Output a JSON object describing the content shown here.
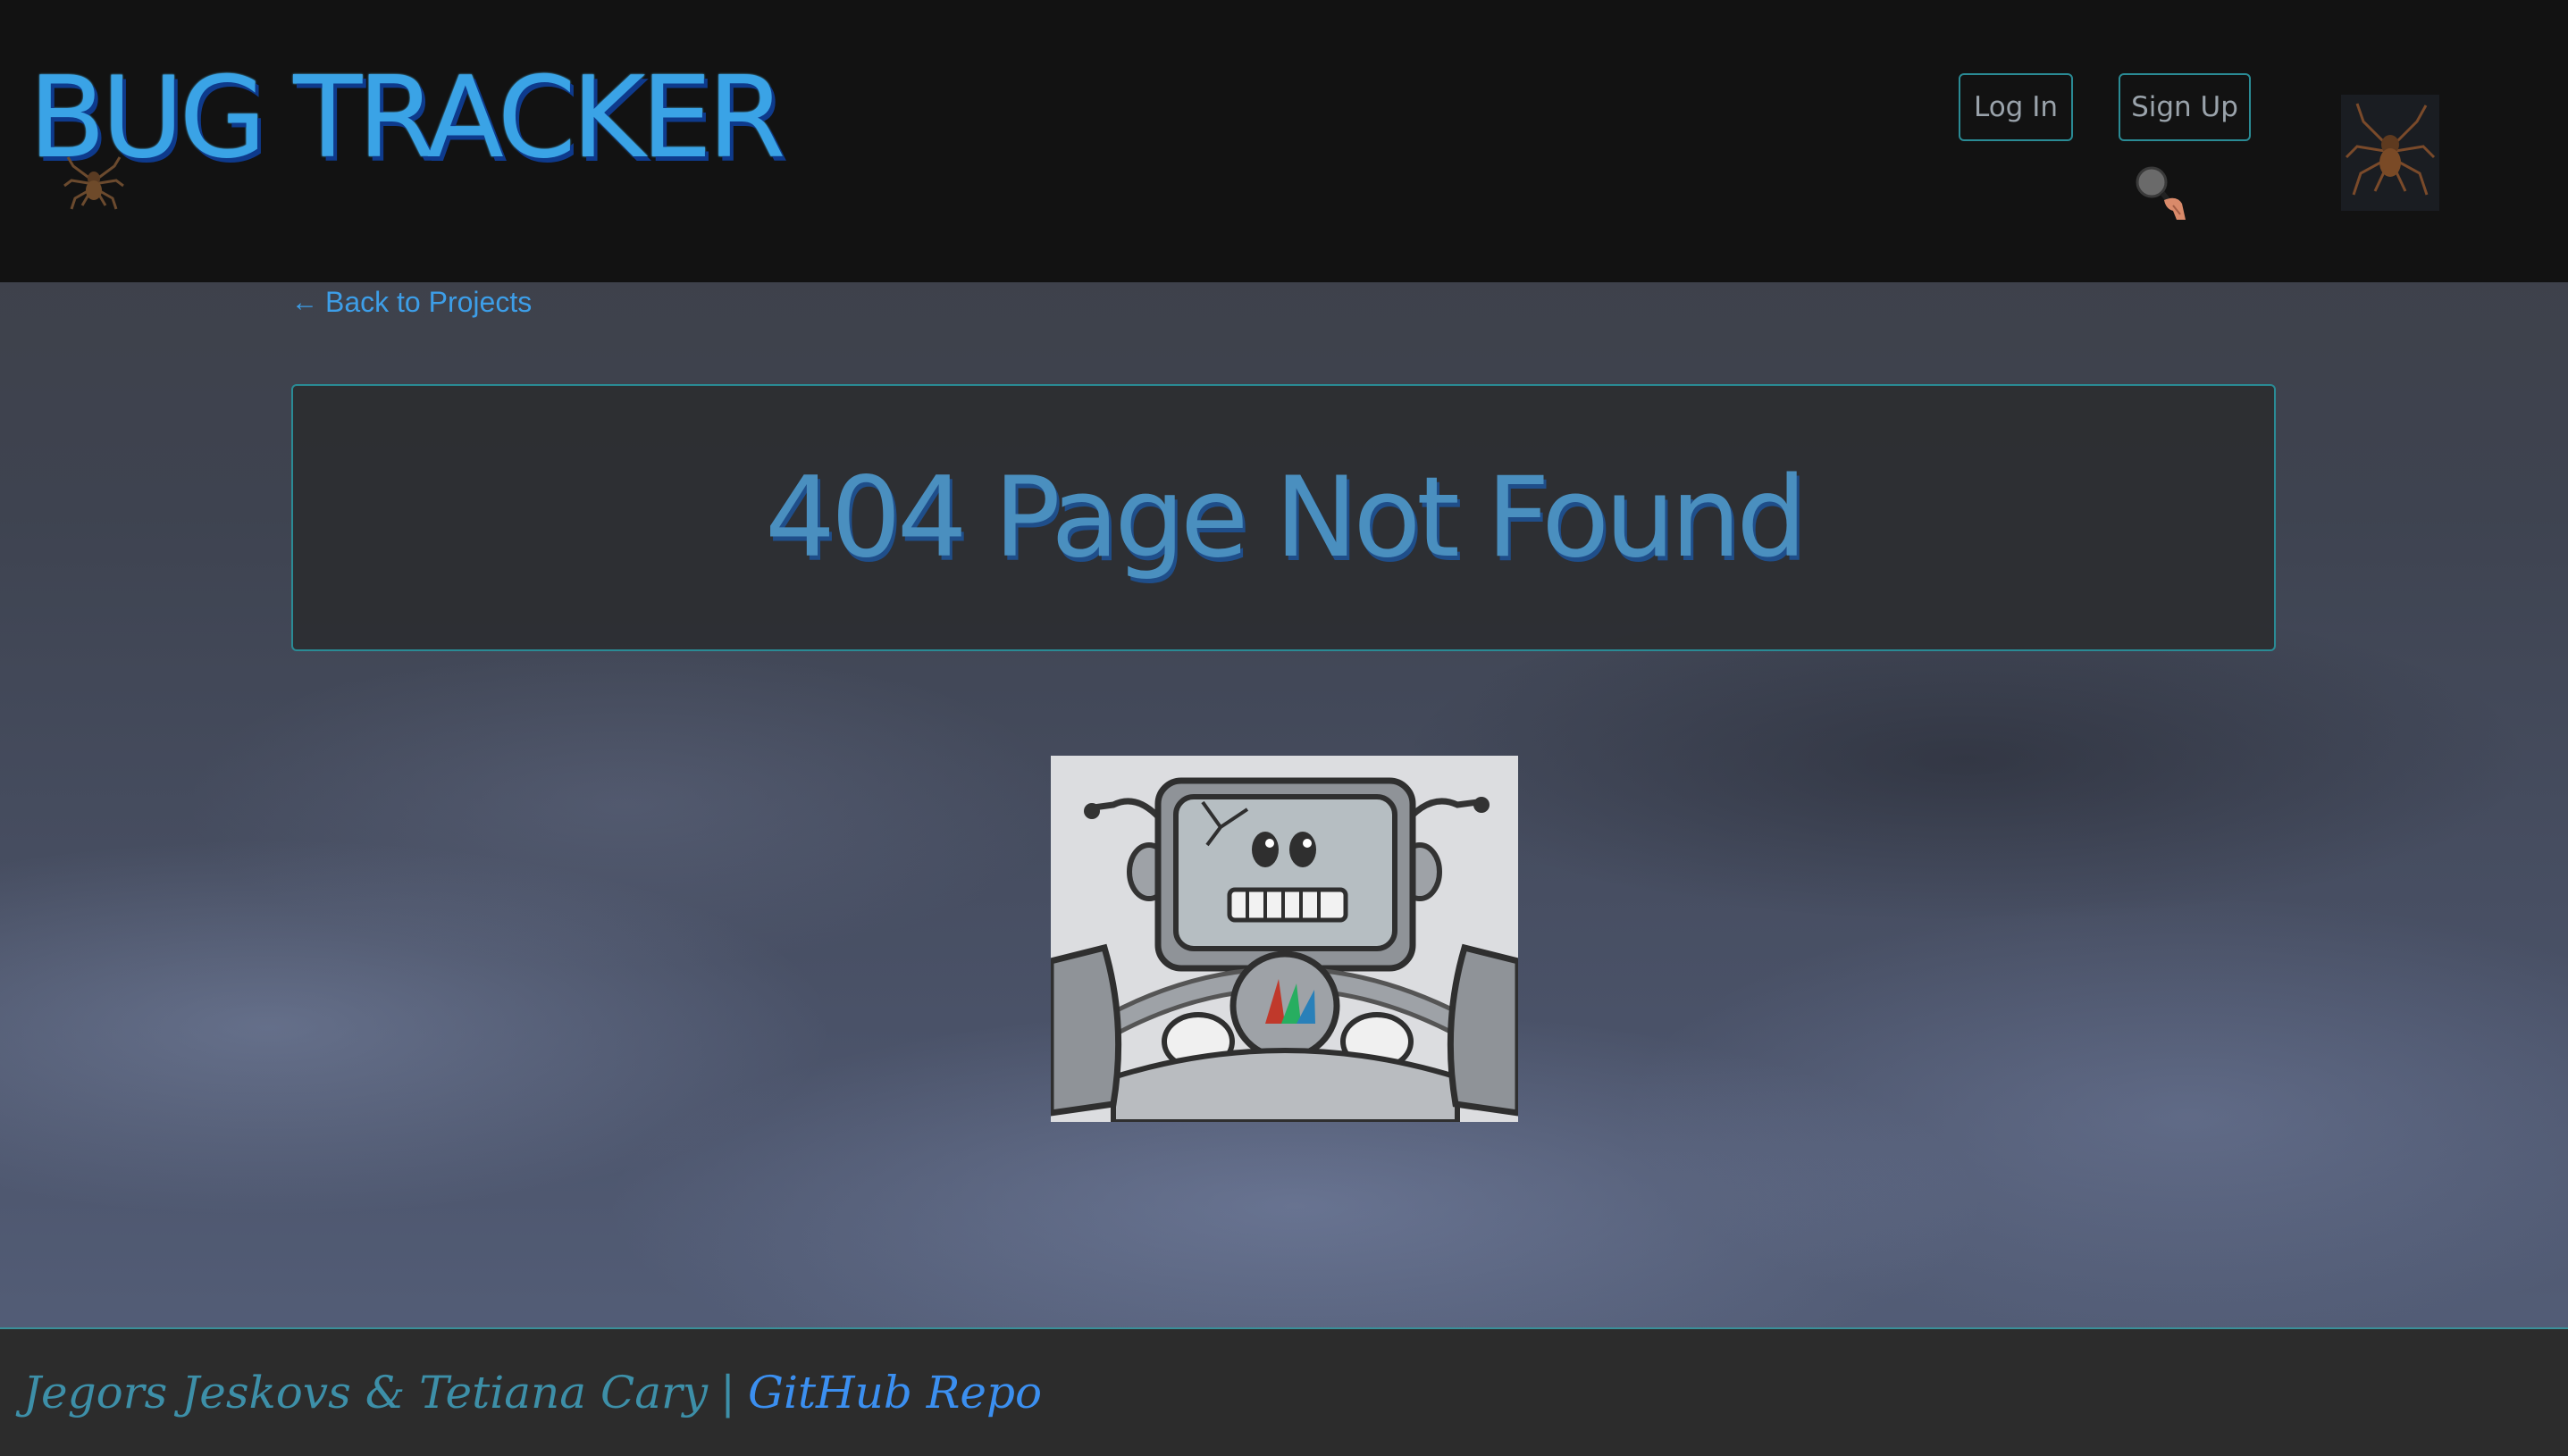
{
  "header": {
    "brand": "BUG TRACKER",
    "login_label": "Log In",
    "signup_label": "Sign Up"
  },
  "main": {
    "back_label": "Back to Projects",
    "back_icon": "arrow-left-icon",
    "heading": "404 Page Not Found",
    "image": "robot-illustration"
  },
  "footer": {
    "authors": "Jegors Jeskovs & Tetiana Cary",
    "separator": "|",
    "repo_label": "GitHub Repo"
  },
  "colors": {
    "accent": "#3aa3e6",
    "border": "#2a8b95",
    "header_bg": "#121212",
    "footer_bg": "#2c2c2c"
  }
}
